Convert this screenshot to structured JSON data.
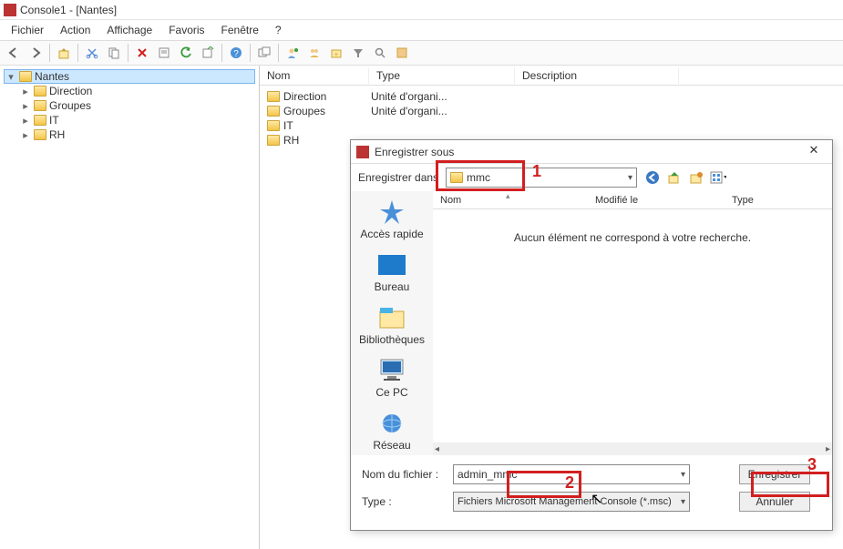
{
  "window": {
    "title": "Console1 - [Nantes]"
  },
  "menu": {
    "file": "Fichier",
    "action": "Action",
    "view": "Affichage",
    "fav": "Favoris",
    "window": "Fenêtre",
    "help": "?"
  },
  "tree": {
    "root": "Nantes",
    "children": [
      {
        "label": "Direction"
      },
      {
        "label": "Groupes"
      },
      {
        "label": "IT"
      },
      {
        "label": "RH"
      }
    ]
  },
  "columns": {
    "name": "Nom",
    "type": "Type",
    "desc": "Description"
  },
  "rows": [
    {
      "name": "Direction",
      "type": "Unité d'organi..."
    },
    {
      "name": "Groupes",
      "type": "Unité d'organi..."
    },
    {
      "name": "IT",
      "type": ""
    },
    {
      "name": "RH",
      "type": ""
    }
  ],
  "dialog": {
    "title": "Enregistrer sous",
    "save_in_label": "Enregistrer dans",
    "save_in_value": "mmc",
    "headers": {
      "name": "Nom",
      "modified": "Modifié le",
      "type": "Type"
    },
    "empty": "Aucun élément ne correspond à votre recherche.",
    "places": {
      "quick": "Accès rapide",
      "desktop": "Bureau",
      "libraries": "Bibliothèques",
      "pc": "Ce PC",
      "network": "Réseau"
    },
    "filename_label": "Nom du fichier :",
    "filename_value": "admin_mmc",
    "type_label": "Type :",
    "type_value": "Fichiers Microsoft Management Console (*.msc)",
    "save_btn": "Enregistrer",
    "cancel_btn": "Annuler"
  },
  "annotations": {
    "a1": "1",
    "a2": "2",
    "a3": "3"
  }
}
